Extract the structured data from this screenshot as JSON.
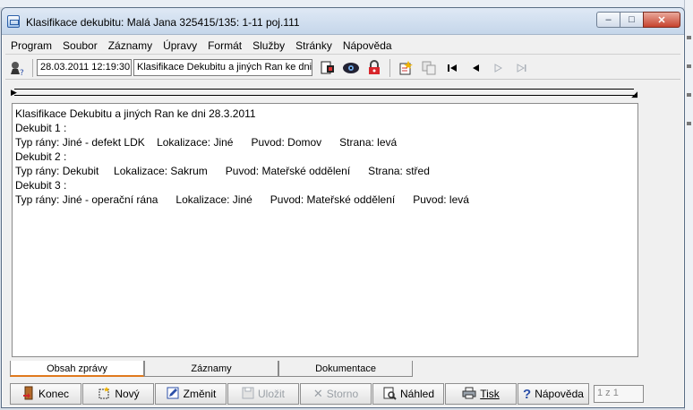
{
  "window": {
    "title": "Klasifikace dekubitu: Malá Jana 325415/135: 1-11 poj.111",
    "minimize": "–",
    "maximize": "□",
    "close": "✕"
  },
  "menu": [
    "Program",
    "Soubor",
    "Záznamy",
    "Úpravy",
    "Formát",
    "Služby",
    "Stránky",
    "Nápověda"
  ],
  "toolbar": {
    "datetime": "28.03.2011 12:19:30",
    "record_title": "Klasifikace Dekubitu a jiných Ran ke dni",
    "icons": [
      "help-pointer-icon",
      "document-icon",
      "eye-icon",
      "lock-icon",
      "new-record-icon",
      "copy-icon",
      "first-record-icon",
      "previous-record-icon",
      "next-record-icon",
      "last-record-icon"
    ]
  },
  "content": {
    "lines": [
      "Klasifikace Dekubitu a jiných Ran ke dni 28.3.2011",
      "Dekubit 1 :",
      "Typ rány: Jiné - defekt LDK    Lokalizace: Jiné      Puvod: Domov      Strana: levá",
      "Dekubit 2 :",
      "Typ rány: Dekubit     Lokalizace: Sakrum      Puvod: Mateřské oddělení      Strana: střed",
      "Dekubit 3 :",
      "Typ rány: Jiné - operační rána      Lokalizace: Jiné      Puvod: Mateřské oddělení      Puvod: levá"
    ]
  },
  "tabs": [
    "Obsah zprávy",
    "Záznamy",
    "Dokumentace"
  ],
  "buttons": {
    "konec": "Konec",
    "novy": "Nový",
    "zmenit": "Změnit",
    "ulozit": "Uložit",
    "storno": "Storno",
    "nahled": "Náhled",
    "tisk": "Tisk",
    "napoveda": "Nápověda"
  },
  "counter": "1 z 1",
  "colors": {
    "active_tab_underline": "#e0791d",
    "close_button": "#c7432e"
  }
}
